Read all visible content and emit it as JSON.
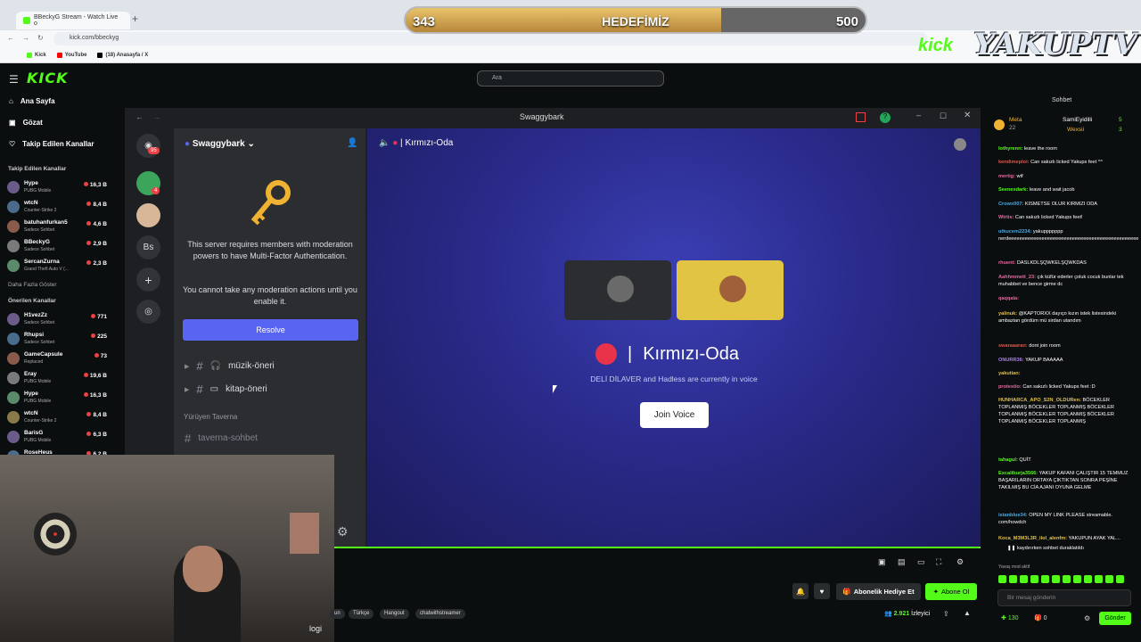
{
  "browser": {
    "tab_title": "BBeckyG Stream - Watch Live o",
    "new_tab": "+",
    "url": "kick.com/bbeckyg",
    "bookmarks": [
      {
        "label": "Kick",
        "icon": "kick-icon",
        "color": "#53fc18"
      },
      {
        "label": "YouTube",
        "icon": "youtube-icon",
        "color": "#ff0000"
      },
      {
        "label": "(18) Anasayfa / X",
        "icon": "x-icon",
        "color": "#000000"
      }
    ]
  },
  "overlay": {
    "goal_current": "343",
    "goal_title": "HEDEFİMİZ",
    "goal_max": "500",
    "goal_progress": 0.686,
    "brand_kick": "kick",
    "brand_name": "YAKUPTV"
  },
  "header": {
    "logo": "KICK",
    "search_placeholder": "Ara"
  },
  "sidebar": {
    "nav": [
      {
        "label": "Ana Sayfa",
        "icon": "home-icon"
      },
      {
        "label": "Gözat",
        "icon": "browse-icon"
      },
      {
        "label": "Takip Edilen Kanallar",
        "icon": "heart-icon"
      }
    ],
    "followed_title": "Takip Edilen Kanallar",
    "followed": [
      {
        "name": "Hype",
        "game": "PUBG Mobile",
        "viewers": "16,3 B"
      },
      {
        "name": "wtcN",
        "game": "Counter-Strike 2",
        "viewers": "8,4 B"
      },
      {
        "name": "batuhanfurkan5",
        "game": "Sadece Sohbet",
        "viewers": "4,6 B"
      },
      {
        "name": "BBeckyG",
        "game": "Sadece Sohbet",
        "viewers": "2,9 B"
      },
      {
        "name": "SercanZurna",
        "game": "Grand Theft Auto V (...",
        "viewers": "2,3 B"
      }
    ],
    "show_more": "Daha Fazla Göster",
    "recommended_title": "Önerilen Kanallar",
    "recommended": [
      {
        "name": "H1vezZz",
        "game": "Sadece Sohbet",
        "viewers": "771"
      },
      {
        "name": "Rhupsi",
        "game": "Sadece Sohbet",
        "viewers": "225"
      },
      {
        "name": "GameCapsule",
        "game": "Replaced",
        "viewers": "73"
      },
      {
        "name": "Eray",
        "game": "PUBG Mobile",
        "viewers": "19,6 B"
      },
      {
        "name": "Hype",
        "game": "PUBG Mobile",
        "viewers": "16,3 B"
      },
      {
        "name": "wtcN",
        "game": "Counter-Strike 2",
        "viewers": "8,4 B"
      },
      {
        "name": "BarisG",
        "game": "PUBG Mobile",
        "viewers": "6,3 B"
      },
      {
        "name": "RoseHeus",
        "game": "",
        "viewers": "6,2 B"
      }
    ]
  },
  "discord": {
    "window_title": "Swaggybark",
    "server_name": "Swaggybark",
    "dm_badge": "95",
    "server_badge": "4",
    "server_abbr": "Bs",
    "mfa_text": "This server requires members with moderation powers to have Multi-Factor Authentication.",
    "mfa_note": "You cannot take any moderation actions until you enable it.",
    "resolve_label": "Resolve",
    "channels": [
      {
        "name": "müzik-öneri",
        "icon": "headphones-icon"
      },
      {
        "name": "kitap-öneri",
        "icon": "book-icon"
      }
    ],
    "category": "Yürüyen Taverna",
    "category_channel": "taverna-sohbet",
    "voice_header": "Kırmızı-Oda",
    "voice_name": "Kırmızı-Oda",
    "voice_desc": "DELİ DİLAVER and Hadless are currently in voice",
    "join_label": "Join Voice"
  },
  "stream": {
    "gift_label": "Abonelik Hediye Et",
    "subscribe_label": "Abone Ol",
    "tags": [
      "un",
      "Türkçe",
      "Hangout",
      "chatwithstreamer"
    ],
    "viewers_count": "2.921",
    "viewers_label": "İzleyici",
    "webcam_text": "logi"
  },
  "chat": {
    "title": "Sohbet",
    "pinned": [
      {
        "name": "Meta",
        "count": "22"
      },
      {
        "name": "SamiEyidilli",
        "count": "5"
      },
      {
        "name": "Wexsii",
        "count": "3"
      }
    ],
    "messages": [
      {
        "user": "lothyrenn:",
        "text": "leave the room",
        "color": "#53fc18"
      },
      {
        "user": "kendimeploi:",
        "text": "Can sakızlı licked Yakups feet ^^",
        "color": "#e0564a"
      },
      {
        "user": "mertig:",
        "text": "wtf",
        "color": "#e06aa0"
      },
      {
        "user": "Seenexdark:",
        "text": "leave and wait jacob",
        "color": "#53fc18"
      },
      {
        "user": "Crowx007:",
        "text": "KISMETSE OLUR KIRMIZI ODA",
        "color": "#4aa8e0"
      },
      {
        "user": "Wirtis:",
        "text": "Can sakızlı licked Yakups feet!",
        "color": "#e06aa0"
      },
      {
        "user": "utkucem2234:",
        "text": "yakuppppppp nerdeeeeeeeeeeeeeeeeeeeeeeeeeeeeeeeeeeeeeeeeeeeeeee",
        "color": "#4aa8e0"
      },
      {
        "user": "rhuent:",
        "text": "DASLKDLŞQWKELŞQWKDAS",
        "color": "#e06aa0"
      },
      {
        "user": "Aahhmmett_23:",
        "text": "çık küfür ederler çoluk cocuk bunlar tek muhabbet ve bence girme dc",
        "color": "#e06aa0"
      },
      {
        "user": "qaqqala:",
        "text": "",
        "color": "#e06aa0"
      },
      {
        "user": "yalinuk:",
        "text": "@KAPTORXX dayıço kızın istek listesindeki ambazian gördüm mü sirdan utandım",
        "color": "#e0c04a"
      },
      {
        "user": "swaraaaran:",
        "text": "dont join room",
        "color": "#e0564a"
      },
      {
        "user": "ONURR36:",
        "text": "YAKUP BAAAAA",
        "color": "#b07aff"
      },
      {
        "user": "yakutian:",
        "text": "",
        "color": "#e0c04a"
      },
      {
        "user": "protestio:",
        "text": "Can sakızlı licked Yakups feet :D",
        "color": "#e06aa0"
      },
      {
        "user": "HUNHARCA_APO_S2N_OLDURen:",
        "text": "BÖCEKLER TOPLANMIŞ BÖCEKLER TOPLANMIŞ BÖCEKLER TOPLANMIŞ BÖCEKLER TOPLANMIŞ BÖCEKLER TOPLANMIŞ BÖCEKLER TOPLANMIŞ",
        "color": "#e0c04a"
      },
      {
        "user": "tahagul:",
        "text": "QUİT",
        "color": "#53fc18"
      },
      {
        "user": "Excaliburja3566:",
        "text": "YAKUP KAFANI ÇALIŞTIR 15 TEMMUZ BAŞARILARIN ORTAYA ÇIKTIKTAN SONRA PEŞİNE TAKILMIŞ BU CİA AJANI OYUNA GELME",
        "color": "#53fc18"
      },
      {
        "user": "istanblue34:",
        "text": "OPEN MY LINK PLEASE streamable. com/howdch",
        "color": "#4aa8e0"
      },
      {
        "user": "Koca_M3M3L3R_ilol_alenfm:",
        "text": "YAKUPUN AYAK YAL...",
        "color": "#e0c04a"
      }
    ],
    "scroll_paused": "kaydırırken sohbet duraklatıldı",
    "slow_mode": "Yavaş mod aktif",
    "input_placeholder": "Bir mesaj gönderin",
    "points": "130",
    "zero_count": "0",
    "send_label": "Gönder"
  }
}
